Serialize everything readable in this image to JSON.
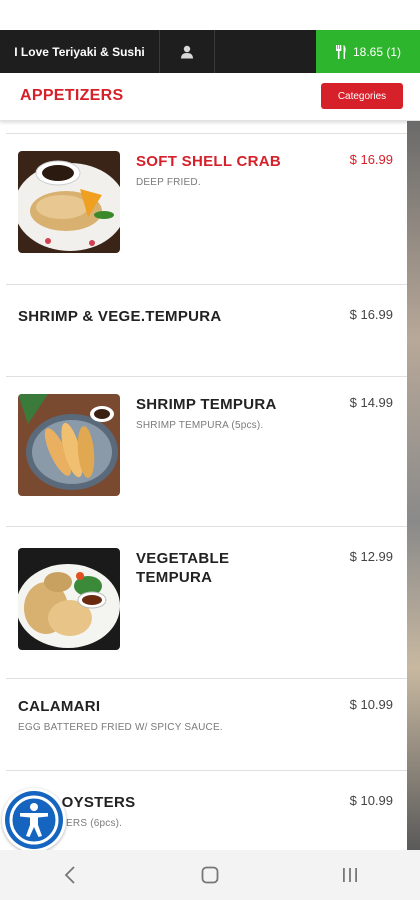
{
  "header": {
    "restaurant_name": "I Love Teriyaki & Sushi",
    "user_icon": "user-icon",
    "cart_icon": "fork-knife-icon",
    "cart_label": "18.65 (1)"
  },
  "category": {
    "title": "APPETIZERS",
    "button_label": "Categories"
  },
  "menu_items": [
    {
      "name": "SOFT SHELL CRAB",
      "description": "DEEP FRIED.",
      "price": "$ 16.99",
      "highlight": true,
      "has_image": true
    },
    {
      "name": "SHRIMP & VEGE.TEMPURA",
      "description": "",
      "price": "$ 16.99",
      "has_image": false
    },
    {
      "name": "SHRIMP TEMPURA",
      "description": "SHRIMP TEMPURA (5pcs).",
      "price": "$ 14.99",
      "has_image": true
    },
    {
      "name": "VEGETABLE TEMPURA",
      "description": "",
      "price": "$ 12.99",
      "has_image": true
    },
    {
      "name": "CALAMARI",
      "description": "EGG BATTERED FRIED W/ SPICY SAUCE.",
      "price": "$ 10.99",
      "has_image": false
    },
    {
      "name": "D OYSTERS",
      "description": "YSTERS (6pcs).",
      "price": "$ 10.99",
      "has_image": false
    }
  ],
  "colors": {
    "brand_red": "#d6202a",
    "cart_green": "#2db52d",
    "topbar_dark": "#1e1e1e"
  },
  "accessibility": {
    "icon": "accessibility-icon"
  },
  "navigation": {
    "back_icon": "back-chevron-icon",
    "home_icon": "home-icon",
    "recents_icon": "recents-icon"
  }
}
